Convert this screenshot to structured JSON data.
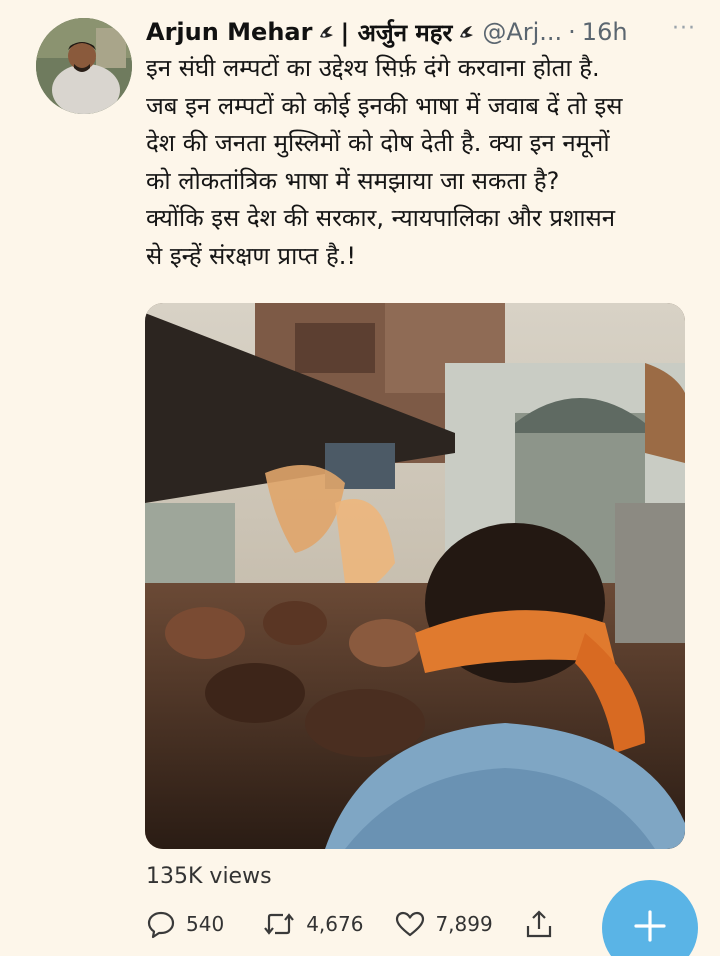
{
  "tweet": {
    "author": {
      "display_name": "Arjun Mehar",
      "hindi_name": "| अर्जुन महर",
      "handle": "@Arj...",
      "time_sep": "·",
      "time": "16h",
      "avatar_icon": "user-photo"
    },
    "more_label": "···",
    "text": "इन संघी लम्पटों का उद्देश्य सिर्फ़ दंगे करवाना होता है.\nजब इन लम्पटों को कोई इनकी भाषा में जवाब दें तो इस\nदेश की जनता मुस्लिमों को दोष देती है. क्या इन नमूनों\nको लोकतांत्रिक भाषा में समझाया जा सकता है?\nक्योंकि इस देश की सरकार, न्यायपालिका और प्रशासन\nसे इन्हें संरक्षण प्राप्त है.!",
    "views_count": "135K",
    "views_label": "views",
    "actions": {
      "replies": "540",
      "retweets": "4,676",
      "likes": "7,899"
    }
  },
  "colors": {
    "background": "#fdf6ea",
    "accent": "#5ab4e6",
    "secondary_text": "#5b6670"
  },
  "icons": {
    "reply": "reply-icon",
    "retweet": "retweet-icon",
    "like": "heart-icon",
    "share": "share-icon",
    "compose": "plus-icon",
    "verified": "emblem-icon"
  }
}
